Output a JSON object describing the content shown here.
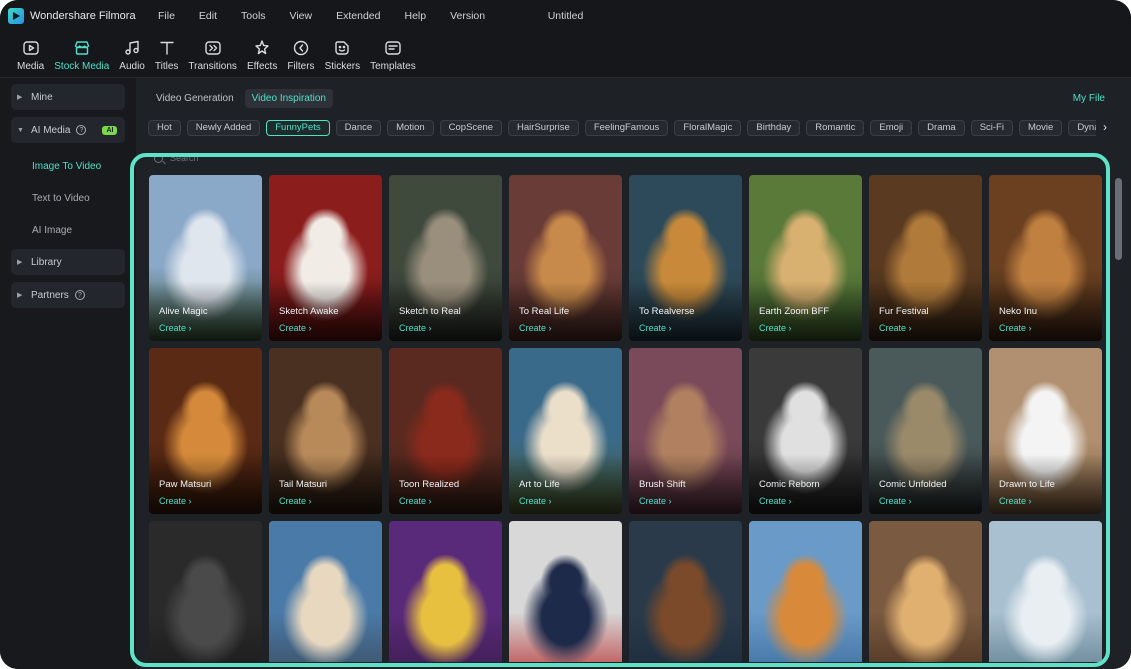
{
  "app": {
    "name": "Wondershare Filmora",
    "doc_title": "Untitled"
  },
  "menu": [
    "File",
    "Edit",
    "Tools",
    "View",
    "Extended",
    "Help",
    "Version"
  ],
  "toolbar": [
    {
      "label": "Media",
      "icon": "media-icon",
      "active": false
    },
    {
      "label": "Stock Media",
      "icon": "stock-media-icon",
      "active": true
    },
    {
      "label": "Audio",
      "icon": "audio-icon",
      "active": false
    },
    {
      "label": "Titles",
      "icon": "titles-icon",
      "active": false
    },
    {
      "label": "Transitions",
      "icon": "transitions-icon",
      "active": false
    },
    {
      "label": "Effects",
      "icon": "effects-icon",
      "active": false
    },
    {
      "label": "Filters",
      "icon": "filters-icon",
      "active": false
    },
    {
      "label": "Stickers",
      "icon": "stickers-icon",
      "active": false
    },
    {
      "label": "Templates",
      "icon": "templates-icon",
      "active": false
    }
  ],
  "sidebar": {
    "mine": "Mine",
    "ai_media": "AI Media",
    "ai_badge": "AI",
    "ai_items": [
      "Image To Video",
      "Text to Video",
      "AI Image"
    ],
    "library": "Library",
    "partners": "Partners"
  },
  "main": {
    "tabs": [
      "Video Generation",
      "Video Inspiration"
    ],
    "active_tab": 1,
    "my_file": "My File",
    "chips": [
      "Hot",
      "Newly Added",
      "FunnyPets",
      "Dance",
      "Motion",
      "CopScene",
      "HairSurprise",
      "FeelingFamous",
      "FloralMagic",
      "Birthday",
      "Romantic",
      "Emoji",
      "Drama",
      "Sci-Fi",
      "Movie",
      "Dynamic"
    ],
    "active_chip": 2,
    "search_placeholder": "Search",
    "create_label": "Create",
    "cards": [
      {
        "title": "Alive Magic",
        "colors": [
          "#8aa8c8",
          "#dfe6ee",
          "#3b5a3a"
        ]
      },
      {
        "title": "Sketch Awake",
        "colors": [
          "#8c1d1d",
          "#f1ece6",
          "#5a1010"
        ]
      },
      {
        "title": "Sketch to Real",
        "colors": [
          "#3f4a3d",
          "#9a8f7d",
          "#2a2e28"
        ]
      },
      {
        "title": "To Real Life",
        "colors": [
          "#6a3c38",
          "#c88a4a",
          "#4a2a24"
        ]
      },
      {
        "title": "To Realverse",
        "colors": [
          "#2d4a5a",
          "#c88a3a",
          "#243a44"
        ]
      },
      {
        "title": "Earth Zoom BFF",
        "colors": [
          "#5a7a3a",
          "#d8b070",
          "#3a5a2a"
        ]
      },
      {
        "title": "Fur Festival",
        "colors": [
          "#5a3a20",
          "#b07a3a",
          "#3a2614"
        ]
      },
      {
        "title": "Neko Inu",
        "colors": [
          "#6a4020",
          "#c08040",
          "#3c2414"
        ]
      },
      {
        "title": "Paw Matsuri",
        "colors": [
          "#5a2a14",
          "#d48a3a",
          "#3a1a0c"
        ]
      },
      {
        "title": "Tail Matsuri",
        "colors": [
          "#4a3020",
          "#b88a5a",
          "#2e1e14"
        ]
      },
      {
        "title": "Toon Realized",
        "colors": [
          "#5a2a20",
          "#8a2a1c",
          "#3a2018"
        ]
      },
      {
        "title": "Art to Life",
        "colors": [
          "#3a6a8a",
          "#ecdfca",
          "#4a5a2a"
        ]
      },
      {
        "title": "Brush Shift",
        "colors": [
          "#7a4a5a",
          "#b08060",
          "#5a3040"
        ]
      },
      {
        "title": "Comic Reborn",
        "colors": [
          "#3a3a3a",
          "#e0e0e0",
          "#1e1e1e"
        ]
      },
      {
        "title": "Comic Unfolded",
        "colors": [
          "#4a5a5a",
          "#9a8a6a",
          "#2a3030"
        ]
      },
      {
        "title": "Drawn to Life",
        "colors": [
          "#b09070",
          "#f4f4f4",
          "#7a5a3a"
        ]
      },
      {
        "title": "",
        "colors": [
          "#2a2a2a",
          "#4a4a4a",
          "#1a1a1a"
        ]
      },
      {
        "title": "",
        "colors": [
          "#4a7aa8",
          "#e8d8c0",
          "#3a4a5a"
        ]
      },
      {
        "title": "",
        "colors": [
          "#5a2a7a",
          "#e8c040",
          "#3a1a4a"
        ]
      },
      {
        "title": "",
        "colors": [
          "#d8d8d8",
          "#1e2a4a",
          "#b83030"
        ]
      },
      {
        "title": "",
        "colors": [
          "#2a3a4a",
          "#7a4a2a",
          "#1a2a3a"
        ]
      },
      {
        "title": "",
        "colors": [
          "#6a9ac8",
          "#d88a3a",
          "#3a6a9a"
        ]
      },
      {
        "title": "",
        "colors": [
          "#7a5a40",
          "#e0b070",
          "#4a3020"
        ]
      },
      {
        "title": "",
        "colors": [
          "#a8c0d0",
          "#e8eef2",
          "#5a7a8a"
        ]
      }
    ]
  },
  "colors": {
    "accent": "#4fe0c9",
    "highlight": "#5ee3c9",
    "bg": "#1b1e23"
  }
}
